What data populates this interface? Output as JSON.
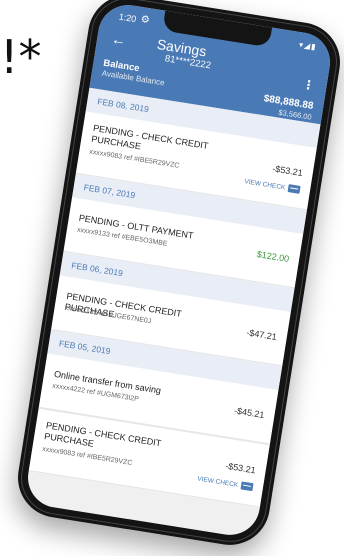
{
  "background": {
    "text": "!*"
  },
  "status": {
    "time": "1:20",
    "right": "▾◢▮"
  },
  "header": {
    "title": "Savings",
    "account": "81****2222",
    "balance_label": "Balance",
    "balance_sub": "Available Balance",
    "balance_amount": "$88,888.88",
    "available_amount": "$3,566.00"
  },
  "icons": {
    "back": "arrow-left-icon",
    "more": "more-vertical-icon",
    "settings": "gear-icon",
    "check": "check-image-icon"
  },
  "colors": {
    "header": "#4a7ab5",
    "date_bg": "#e9eef6",
    "positive": "#3a9a3a"
  },
  "transactions": [
    {
      "date": "FEB 08, 2019",
      "desc": "PENDING - CHECK CREDIT PURCHASE",
      "ref": "xxxxx9083 ref #IBE5R29VZC",
      "amount": "-$53.21",
      "action": "VIEW CHECK"
    },
    {
      "date": "FEB 07, 2019",
      "desc": "PENDING - OLTT PAYMENT",
      "ref": "xxxxx9133 ref #EBE5O3MBE",
      "amount": "$122.00",
      "action": ""
    },
    {
      "date": "FEB 06, 2019",
      "desc": "PENDING - CHECK CREDIT PURCHASE",
      "ref": "xxxxx2132 ref #JGE67NE0J",
      "amount": "-$47.21",
      "action": ""
    },
    {
      "date": "FEB 05, 2019",
      "desc": "Online transfer from saving",
      "ref": "xxxxx4222 ref #UGM673I2P",
      "amount": "-$45.21",
      "action": ""
    },
    {
      "date": "",
      "desc": "PENDING - CHECK CREDIT PURCHASE",
      "ref": "xxxxx9083 ref #IBE5R29VZC",
      "amount": "-$53.21",
      "action": "VIEW CHECK"
    }
  ]
}
